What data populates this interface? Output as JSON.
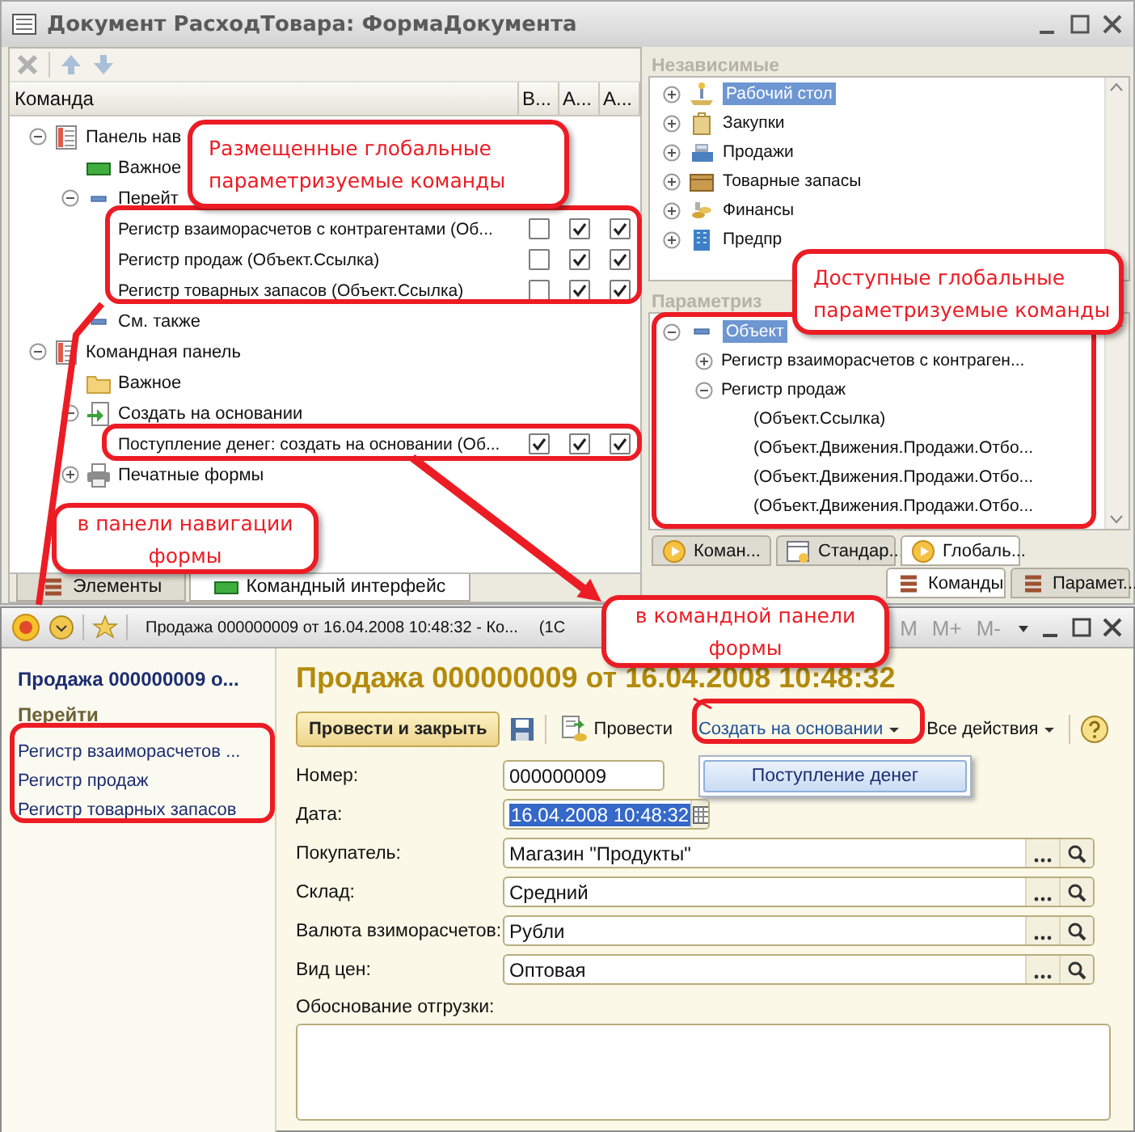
{
  "designer": {
    "title": "Документ РасходТовара: ФормаДокумента",
    "columns": [
      "Команда",
      "В...",
      "А...",
      "А..."
    ],
    "tree": [
      {
        "label": "Панель нав",
        "kind": "panel",
        "expanded": true,
        "children": [
          {
            "label": "Важное",
            "kind": "green-group"
          },
          {
            "label": "Перейт",
            "kind": "dash",
            "expanded": true,
            "children": [
              {
                "label": "Регистр взаиморасчетов с контрагентами (Об...",
                "checks": [
                  false,
                  true,
                  true
                ]
              },
              {
                "label": "Регистр продаж (Объект.Ссылка)",
                "checks": [
                  false,
                  true,
                  true
                ]
              },
              {
                "label": "Регистр товарных запасов (Объект.Ссылка)",
                "checks": [
                  false,
                  true,
                  true
                ]
              }
            ]
          },
          {
            "label": "См. также",
            "kind": "dash"
          }
        ]
      },
      {
        "label": "Командная панель",
        "kind": "panel",
        "expanded": true,
        "children": [
          {
            "label": "Важное",
            "kind": "folder"
          },
          {
            "label": "Создать на основании",
            "kind": "create",
            "expanded": true,
            "children": [
              {
                "label": "Поступление денег: создать на основании (Об...",
                "checks": [
                  true,
                  true,
                  true
                ]
              }
            ]
          },
          {
            "label": "Печатные формы",
            "kind": "printer",
            "expanded": false
          }
        ]
      }
    ],
    "tabs": [
      {
        "label": "Элементы",
        "selected": false
      },
      {
        "label": "Командный интерфейс",
        "selected": true
      }
    ]
  },
  "commands": {
    "independent": {
      "title": "Независимые",
      "items": [
        {
          "label": "Рабочий стол",
          "kind": "desk",
          "expanded": false,
          "selected": true
        },
        {
          "label": "Закупки",
          "kind": "bag",
          "expanded": false,
          "selected": false
        },
        {
          "label": "Продажи",
          "kind": "register",
          "expanded": false,
          "selected": false
        },
        {
          "label": "Товарные запасы",
          "kind": "box",
          "expanded": false,
          "selected": false
        },
        {
          "label": "Финансы",
          "kind": "coins",
          "expanded": false,
          "selected": false
        },
        {
          "label": "Предпр",
          "kind": "building",
          "expanded": false,
          "selected": false
        }
      ]
    },
    "parametrized": {
      "title": "Параметриз",
      "tree": [
        {
          "label": "Объект",
          "kind": "dash",
          "expanded": true,
          "selected": true,
          "children": [
            {
              "label": "Регистр взаиморасчетов с контраген...",
              "expanded": false,
              "selected": false
            },
            {
              "label": "Регистр продаж",
              "expanded": true,
              "selected": false,
              "children": [
                {
                  "label": "(Объект.Ссылка)",
                  "selected": false
                },
                {
                  "label": "(Объект.Движения.Продажи.Отбо...",
                  "selected": false
                },
                {
                  "label": "(Объект.Движения.Продажи.Отбо...",
                  "selected": false
                },
                {
                  "label": "(Объект.Движения.Продажи.Отбо...",
                  "selected": false
                }
              ]
            }
          ]
        }
      ]
    },
    "tabs": [
      [
        {
          "label": "Коман...",
          "kind": "play",
          "selected": false
        },
        {
          "label": "Стандар...",
          "kind": "form",
          "selected": false
        },
        {
          "label": "Глобаль...",
          "kind": "play",
          "selected": true
        }
      ],
      [
        {
          "label": "Команды",
          "kind": "stack",
          "selected": true
        },
        {
          "label": "Парамет...",
          "kind": "stack",
          "selected": false
        }
      ]
    ]
  },
  "form": {
    "title": "Продажа 000000009 от 16.04.2008 10:48:32 - Ко...",
    "title_suffix": "(1С",
    "memory_buttons": [
      "M",
      "M+",
      "M-"
    ],
    "nav": {
      "title": "Продажа 000000009 о...",
      "section": "Перейти",
      "links": [
        "Регистр взаиморасчетов ...",
        "Регистр продаж",
        "Регистр товарных запасов"
      ]
    },
    "heading": "Продажа 000000009 от 16.04.2008 10:48:32",
    "toolbar": [
      {
        "kind": "primary",
        "label": "Провести и закрыть"
      },
      {
        "kind": "save"
      },
      {
        "kind": "post",
        "label": "Провести"
      },
      {
        "kind": "menu",
        "label": "Создать на основании",
        "open": true,
        "menu_items": [
          "Поступление денег"
        ]
      },
      {
        "kind": "menu",
        "label": "Все действия",
        "open": false
      },
      {
        "kind": "help"
      }
    ],
    "fields": [
      {
        "label": "Номер:",
        "value": "000000009",
        "kind": "short",
        "text_selected": false
      },
      {
        "label": "Дата:",
        "value": "16.04.2008 10:48:32",
        "kind": "date",
        "text_selected": true
      },
      {
        "label": "Покупатель:",
        "value": "Магазин \"Продукты\"",
        "kind": "reference",
        "text_selected": false
      },
      {
        "label": "Склад:",
        "value": "Средний",
        "kind": "reference",
        "text_selected": false
      },
      {
        "label": "Валюта взиморасчетов:",
        "value": "Рубли",
        "kind": "reference",
        "text_selected": false
      },
      {
        "label": "Вид цен:",
        "value": "Оптовая",
        "kind": "reference",
        "text_selected": false
      }
    ],
    "memo": {
      "label": "Обоснование отгрузки:"
    }
  },
  "annotations": [
    {
      "text": "Размещенные глобальные параметризуемые команды"
    },
    {
      "text": "Доступные глобальные параметризуемые команды"
    },
    {
      "text": "в панели навигации формы"
    },
    {
      "text": "в командной панели формы"
    }
  ]
}
